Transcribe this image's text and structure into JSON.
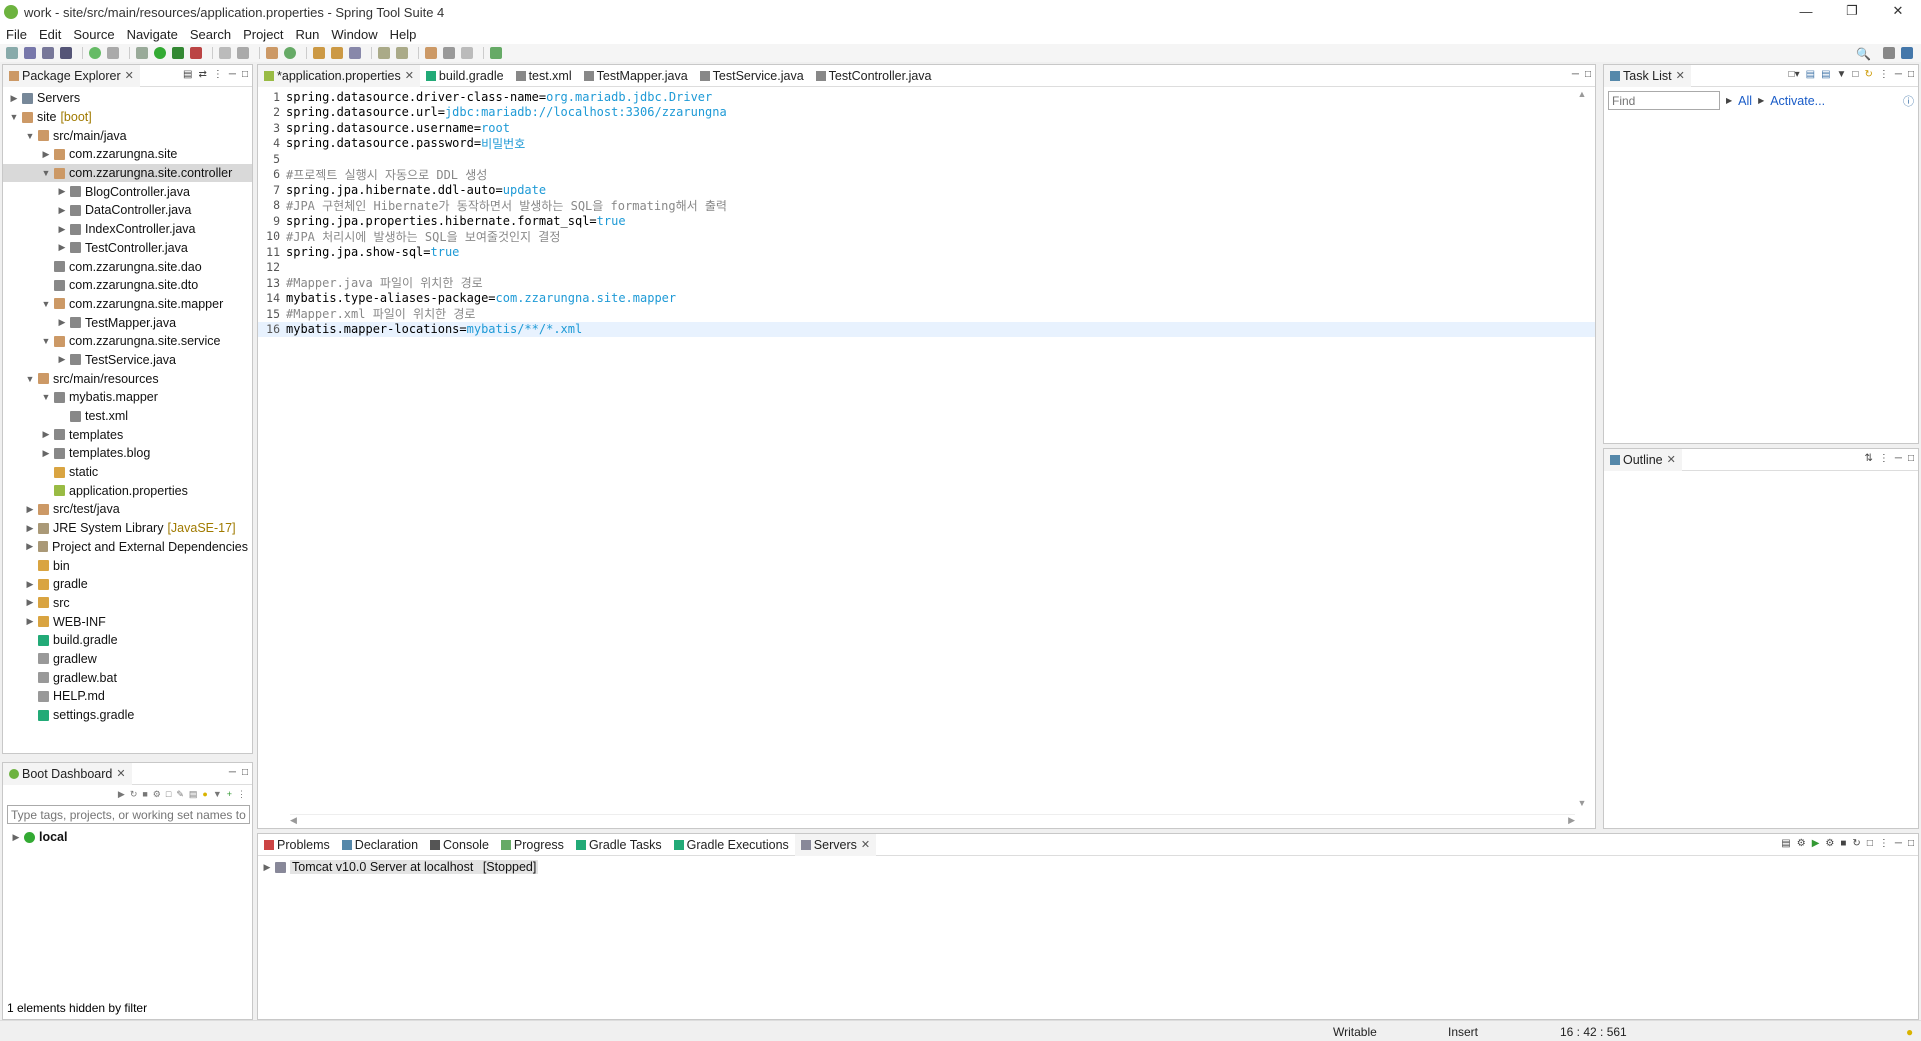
{
  "window": {
    "title": "work - site/src/main/resources/application.properties - Spring Tool Suite 4"
  },
  "menu": [
    "File",
    "Edit",
    "Source",
    "Navigate",
    "Search",
    "Project",
    "Run",
    "Window",
    "Help"
  ],
  "package_explorer": {
    "tab_label": "Package Explorer",
    "items": [
      {
        "label": "Servers",
        "decor": ""
      },
      {
        "label": "site",
        "decor": "[boot]"
      },
      {
        "label": "src/main/java",
        "decor": ""
      },
      {
        "label": "com.zzarungna.site",
        "decor": ""
      },
      {
        "label": "com.zzarungna.site.controller",
        "decor": ""
      },
      {
        "label": "BlogController.java",
        "decor": ""
      },
      {
        "label": "DataController.java",
        "decor": ""
      },
      {
        "label": "IndexController.java",
        "decor": ""
      },
      {
        "label": "TestController.java",
        "decor": ""
      },
      {
        "label": "com.zzarungna.site.dao",
        "decor": ""
      },
      {
        "label": "com.zzarungna.site.dto",
        "decor": ""
      },
      {
        "label": "com.zzarungna.site.mapper",
        "decor": ""
      },
      {
        "label": "TestMapper.java",
        "decor": ""
      },
      {
        "label": "com.zzarungna.site.service",
        "decor": ""
      },
      {
        "label": "TestService.java",
        "decor": ""
      },
      {
        "label": "src/main/resources",
        "decor": ""
      },
      {
        "label": "mybatis.mapper",
        "decor": ""
      },
      {
        "label": "test.xml",
        "decor": ""
      },
      {
        "label": "templates",
        "decor": ""
      },
      {
        "label": "templates.blog",
        "decor": ""
      },
      {
        "label": "static",
        "decor": ""
      },
      {
        "label": "application.properties",
        "decor": ""
      },
      {
        "label": "src/test/java",
        "decor": ""
      },
      {
        "label": "JRE System Library",
        "decor": "[JavaSE-17]"
      },
      {
        "label": "Project and External Dependencies",
        "decor": ""
      },
      {
        "label": "bin",
        "decor": ""
      },
      {
        "label": "gradle",
        "decor": ""
      },
      {
        "label": "src",
        "decor": ""
      },
      {
        "label": "WEB-INF",
        "decor": ""
      },
      {
        "label": "build.gradle",
        "decor": ""
      },
      {
        "label": "gradlew",
        "decor": ""
      },
      {
        "label": "gradlew.bat",
        "decor": ""
      },
      {
        "label": "HELP.md",
        "decor": ""
      },
      {
        "label": "settings.gradle",
        "decor": ""
      }
    ]
  },
  "boot_dashboard": {
    "tab_label": "Boot Dashboard",
    "filter_placeholder": "Type tags, projects, or working set names to",
    "item": "local",
    "footer": "1 elements hidden by filter"
  },
  "editor": {
    "tabs": [
      "*application.properties",
      "build.gradle",
      "test.xml",
      "TestMapper.java",
      "TestService.java",
      "TestController.java"
    ],
    "lines": [
      {
        "n": "1",
        "key": "spring.datasource.driver-class-name=",
        "val": "org.mariadb.jdbc.Driver"
      },
      {
        "n": "2",
        "key": "spring.datasource.url=",
        "val": "jdbc:mariadb://localhost:3306/zzarungna"
      },
      {
        "n": "3",
        "key": "spring.datasource.username=",
        "val": "root"
      },
      {
        "n": "4",
        "key": "spring.datasource.password=",
        "val": "비밀번호"
      },
      {
        "n": "5",
        "key": "",
        "val": ""
      },
      {
        "n": "6",
        "comment": "#프로젝트 실행시 자동으로 DDL 생성"
      },
      {
        "n": "7",
        "key": "spring.jpa.hibernate.ddl-auto=",
        "val": "update"
      },
      {
        "n": "8",
        "comment": "#JPA 구현체인 Hibernate가 동작하면서 발생하는 SQL을 formating해서 출력"
      },
      {
        "n": "9",
        "key": "spring.jpa.properties.hibernate.format_sql=",
        "val": "true"
      },
      {
        "n": "10",
        "comment": "#JPA 처리시에 발생하는 SQL을 보여줄것인지 결정"
      },
      {
        "n": "11",
        "key": "spring.jpa.show-sql=",
        "val": "true"
      },
      {
        "n": "12",
        "key": "",
        "val": ""
      },
      {
        "n": "13",
        "comment": "#Mapper.java 파일이 위치한 경로"
      },
      {
        "n": "14",
        "key": "mybatis.type-aliases-package=",
        "val": "com.zzarungna.site.mapper"
      },
      {
        "n": "15",
        "comment": "#Mapper.xml 파일이 위치한 경로"
      },
      {
        "n": "16",
        "key": "mybatis.mapper-locations=",
        "val": "mybatis/**/*.xml"
      }
    ]
  },
  "task_list": {
    "tab_label": "Task List",
    "find_placeholder": "Find",
    "all_label": "All",
    "activate_label": "Activate..."
  },
  "outline": {
    "tab_label": "Outline"
  },
  "bottom_panel": {
    "tabs": [
      "Problems",
      "Declaration",
      "Console",
      "Progress",
      "Gradle Tasks",
      "Gradle Executions",
      "Servers"
    ],
    "server_item": "Tomcat v10.0 Server at localhost",
    "server_state": "[Stopped]"
  },
  "status": {
    "writable": "Writable",
    "insert": "Insert",
    "position": "16 : 42 : 561"
  },
  "colors": {
    "spring_green": "#6db33f",
    "value_blue": "#1e9ad6",
    "selection": "#d9d9d9"
  }
}
